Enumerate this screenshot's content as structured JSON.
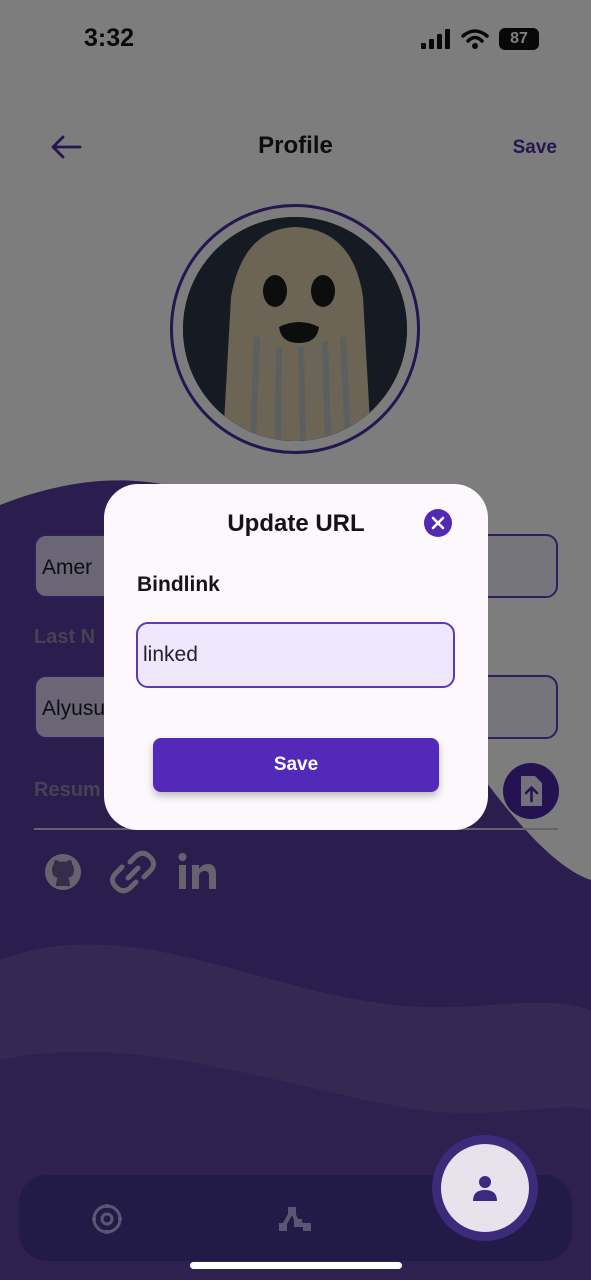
{
  "status_bar": {
    "time": "3:32",
    "battery": "87"
  },
  "header": {
    "title": "Profile",
    "save_label": "Save"
  },
  "form": {
    "first_name_value": "Amer",
    "last_name_label": "Last N",
    "last_name_value": "Alyusu",
    "resume_label": "Resum"
  },
  "modal": {
    "title": "Update URL",
    "field_label": "Bindlink",
    "input_value": "linked",
    "save_label": "Save"
  },
  "colors": {
    "accent": "#5229b8",
    "nav_bg": "#231b47",
    "wave": "#4b2f8a"
  }
}
